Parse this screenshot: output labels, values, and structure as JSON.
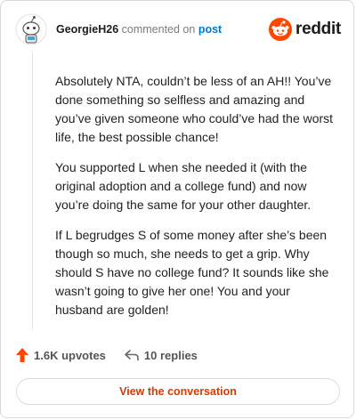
{
  "header": {
    "username": "GeorgieH26",
    "action_text": "commented on",
    "post_link": "post",
    "brand": "reddit",
    "brand_color": "#ff4500"
  },
  "comment": {
    "paragraphs": [
      "Absolutely NTA, couldn’t be less of an AH!! You’ve done something so selfless and amazing and you’ve given someone who could’ve had the worst life, the best possible chance!",
      "You supported L when she needed it (with the original adoption and a college fund) and now you’re doing the same for your other daughter.",
      "If L begrudges S of some money after she’s been though so much, she needs to get a grip. Why should S have no college fund? It sounds like she wasn’t going to give her one! You and your husband are golden!"
    ]
  },
  "footer": {
    "upvotes": "1.6K upvotes",
    "replies": "10 replies",
    "upvote_icon": "upvote-arrow-icon",
    "reply_icon": "reply-arrow-icon",
    "upvote_color": "#ff4500"
  },
  "cta": {
    "label": "View the conversation",
    "color": "#d93a00"
  }
}
